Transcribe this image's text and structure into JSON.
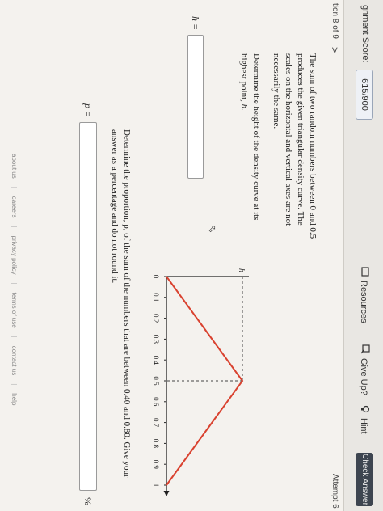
{
  "header": {
    "score_label": "gnment Score:",
    "score_value": "615/900",
    "resources": "Resources",
    "give_up": "Give Up?",
    "hint": "Hint",
    "check_answer": "Check Answer"
  },
  "nav": {
    "question_label": "tion 8 of 9",
    "next_chevron": ">",
    "attempt": "Attempt 6"
  },
  "question": {
    "intro": "The sum of two random numbers between 0 and 0.5 produces the given triangular density curve. The scales on the horizontal and vertical axes are not necessarily the same.",
    "height_prompt": "Determine the height of the density curve at its highest point,",
    "height_var": "h.",
    "h_label": "h =",
    "h_value": "",
    "proportion_prompt": "Determine the proportion, p, of the sum of the numbers that are between 0.40 and 0.80. Give your answer as a percentage and do not round it.",
    "p_label": "p =",
    "p_value": "",
    "percent_sign": "%"
  },
  "graph": {
    "y_label": "h",
    "x_ticks": [
      "0",
      "0.1",
      "0.2",
      "0.3",
      "0.4",
      "0.5",
      "0.6",
      "0.7",
      "0.8",
      "0.9",
      "1"
    ],
    "peak_x": 0.5,
    "line_color": "#d9422f",
    "axis_color": "#222222"
  },
  "footer": {
    "links": [
      "about us",
      "careers",
      "privacy policy",
      "terms of use",
      "contact us",
      "help"
    ]
  }
}
